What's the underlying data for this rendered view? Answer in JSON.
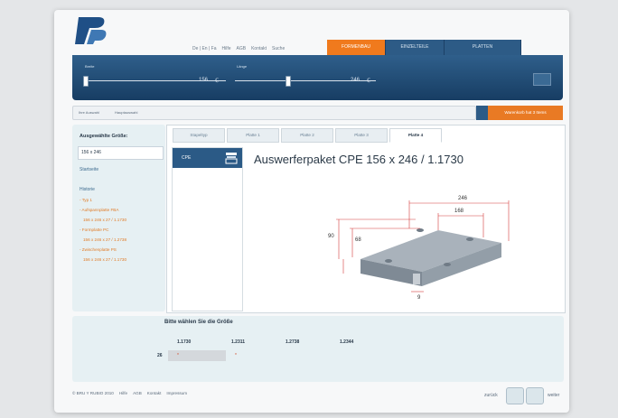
{
  "top_links": [
    "De | En | Fa",
    "Hilfe",
    "AGB",
    "Kontakt",
    "Suche"
  ],
  "nav_tabs": [
    "FORMENBAU",
    "EINZELTEILE",
    "PLATTEN"
  ],
  "active_tab_index": 0,
  "sliders": {
    "width": {
      "label": "Breite",
      "value": "156",
      "unit": "ℂ"
    },
    "length": {
      "label": "Länge",
      "value": "246",
      "unit": "ℂ"
    }
  },
  "breadcrumb": [
    "Ihre Auswahl",
    "Hauptauswahl"
  ],
  "cart_label": "Warenkorb hat 3 Items",
  "sidebar": {
    "title": "Ausgewählte Größe:",
    "selected_size": "156 x 246",
    "start_link": "Startseite",
    "history_title": "Historie",
    "history": [
      "- Typ 1",
      "- Aufspannplatte FBA",
      "156 x 246 x 27 / 1.1730",
      "- Formplatte PC",
      "156 x 246 x 27 / 1.2738",
      "- Zwischenplatte PS",
      "156 x 246 x 27 / 1.1730"
    ]
  },
  "plate_tabs": [
    "Stapeltyp",
    "Platte 1",
    "Platte 2",
    "Platte 3",
    "Platte 4"
  ],
  "active_plate_tab": 4,
  "component_list": [
    "CPE"
  ],
  "product_title": "Auswerferpaket CPE 156 x 246 / 1.1730",
  "dimensions": [
    "246",
    "168",
    "90",
    "68",
    "9"
  ],
  "bottom": {
    "choose_size": "Bitte wählen Sie die Größe",
    "columns": [
      "1.1730",
      "1.2311",
      "1.2738",
      "1.2344"
    ],
    "row_label": "26",
    "cells": [
      "*",
      "*"
    ]
  },
  "footer": [
    "© BRU Y RUBIO 2010",
    "Hilfe",
    "AGB",
    "Kontakt",
    "Impressum"
  ],
  "nav": {
    "back": "zurück",
    "forward": "weiter"
  }
}
